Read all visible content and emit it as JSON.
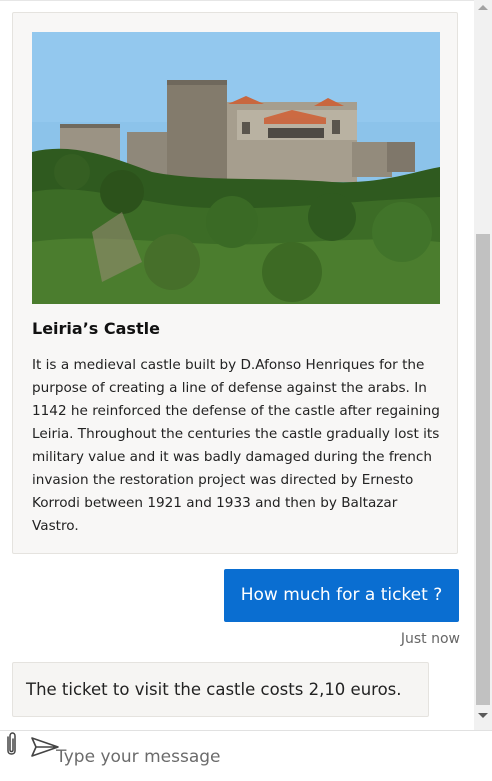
{
  "card": {
    "image_alt": "Leiria's Castle photo",
    "title": "Leiria’s Castle",
    "text": "It is a medieval castle built by D.Afonso Henriques for the purpose of creating a line of defense against the arabs. In 1142 he reinforced the defense of the castle after regaining Leiria. Throughout the centuries the castle gradually lost its military value and it was badly damaged during the french invasion the restoration project was directed by Ernesto Korrodi between 1921 and 1933 and then by Baltazar Vastro."
  },
  "messages": {
    "user_message": "How much for a ticket ?",
    "timestamp": "Just now",
    "bot_reply": "The ticket to visit the castle costs 2,10 euros."
  },
  "composer": {
    "placeholder": "Type your message",
    "attach_icon": "paperclip-icon",
    "send_icon": "send-icon"
  },
  "colors": {
    "user_bubble": "#0a6ed1",
    "card_background": "#f8f7f6",
    "scroll_thumb": "#c1c1c1"
  }
}
